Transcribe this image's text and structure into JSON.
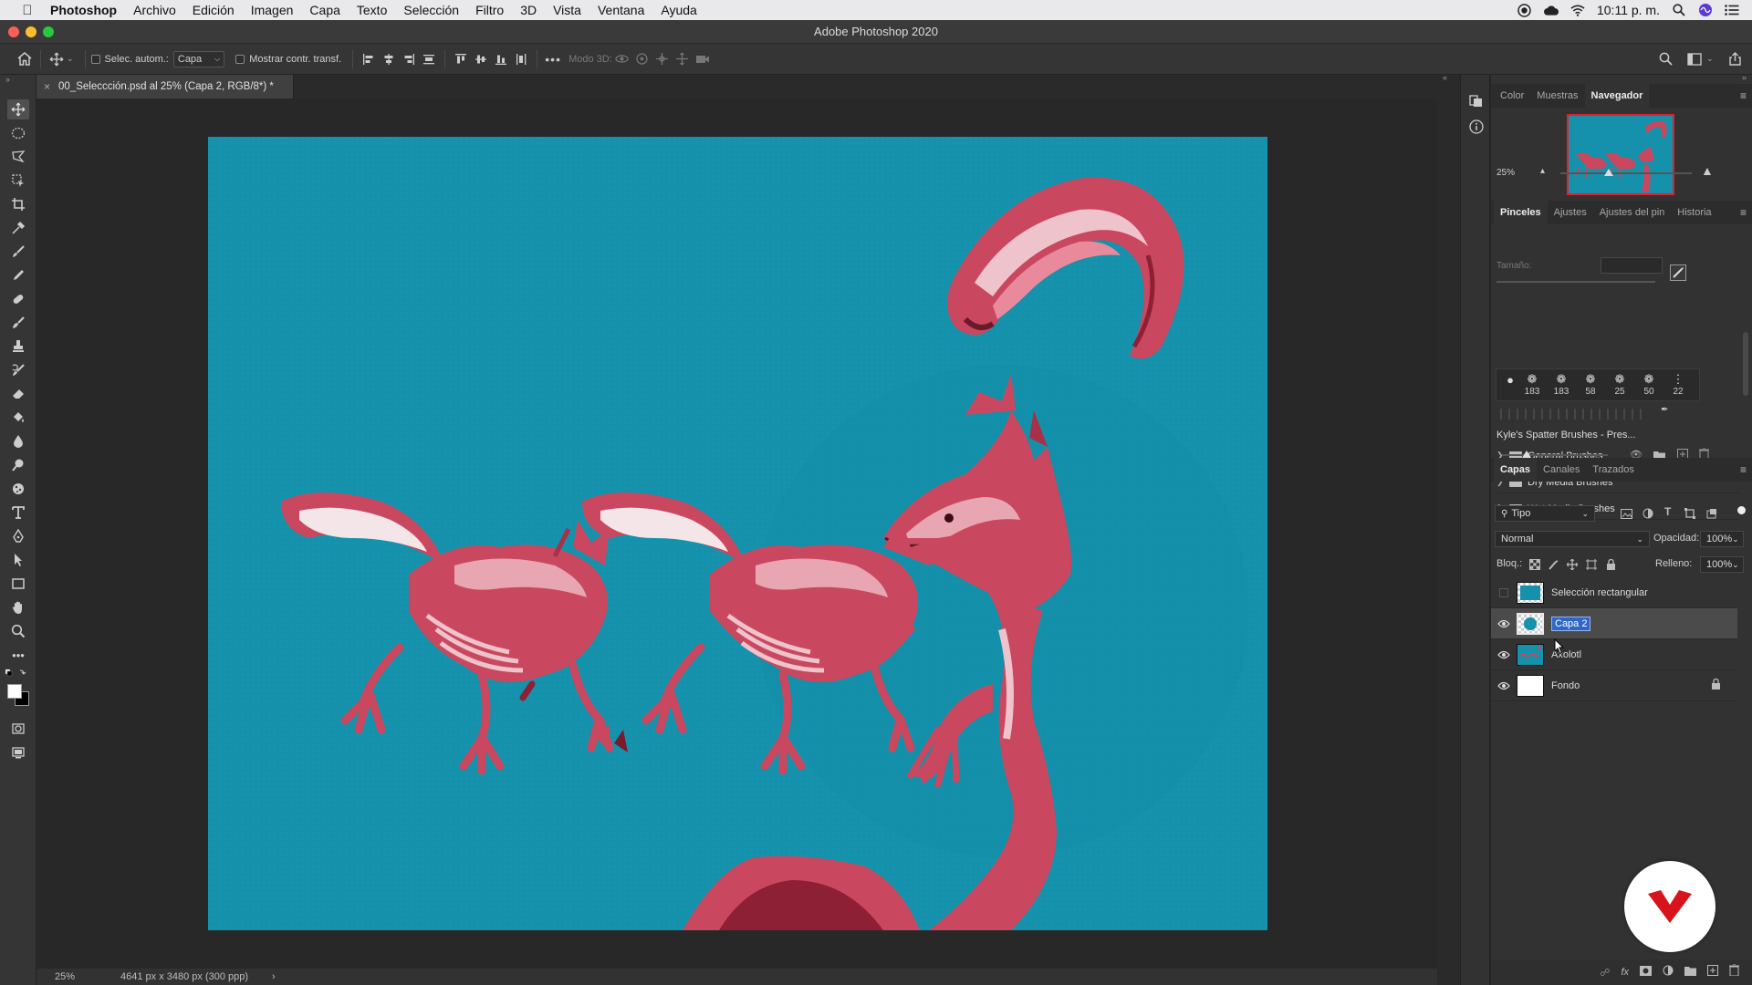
{
  "menubar": {
    "app_name": "Photoshop",
    "items": [
      "Archivo",
      "Edición",
      "Imagen",
      "Capa",
      "Texto",
      "Selección",
      "Filtro",
      "3D",
      "Vista",
      "Ventana",
      "Ayuda"
    ],
    "clock": "10:11 p. m."
  },
  "window": {
    "title": "Adobe Photoshop 2020"
  },
  "options": {
    "auto_select_label": "Selec. autom.:",
    "auto_select_value": "Capa",
    "show_transform_label": "Mostrar contr. transf.",
    "mode_3d_label": "Modo 3D:"
  },
  "document": {
    "tab_title": "00_Seleccción.psd al 25% (Capa 2, RGB/8*) *",
    "tab_close": "×"
  },
  "status": {
    "zoom": "25%",
    "dimensions": "4641 px x 3480 px (300 ppp)",
    "arrow": "›"
  },
  "navigator": {
    "tabs": [
      "Color",
      "Muestras",
      "Navegador"
    ],
    "active_tab": "Navegador",
    "zoom": "25%",
    "zoom_slider_fraction": 0.37
  },
  "brushes": {
    "tabs": [
      "Pinceles",
      "Ajustes",
      "Ajustes del pin",
      "Historia"
    ],
    "active_tab": "Pinceles",
    "size_label": "Tamaño:",
    "brush_sizes": [
      "183",
      "183",
      "58",
      "25",
      "50",
      "22"
    ],
    "preset_name": "Kyle's Spatter Brushes - Pres...",
    "folders": [
      "General Brushes",
      "Dry Media Brushes",
      "Wet Media Brushes"
    ]
  },
  "layers": {
    "tabs": [
      "Capas",
      "Canales",
      "Trazados"
    ],
    "active_tab": "Capas",
    "filter_kind": "Tipo",
    "blend_mode": "Normal",
    "opacity_label": "Opacidad:",
    "opacity_value": "100%",
    "lock_label": "Bloq.:",
    "fill_label": "Relleno:",
    "fill_value": "100%",
    "items": [
      {
        "name": "Selección rectangular",
        "visible": false
      },
      {
        "name": "Capa 2",
        "visible": true,
        "selected": true
      },
      {
        "name": "Axolotl",
        "visible": true
      },
      {
        "name": "Fondo",
        "visible": true,
        "locked": true
      }
    ]
  },
  "colors": {
    "canvas_bg": "#1591ab",
    "axolotl_pink": "#c9485f",
    "axolotl_light": "#e8a6b2",
    "brand_red": "#d8131b"
  }
}
